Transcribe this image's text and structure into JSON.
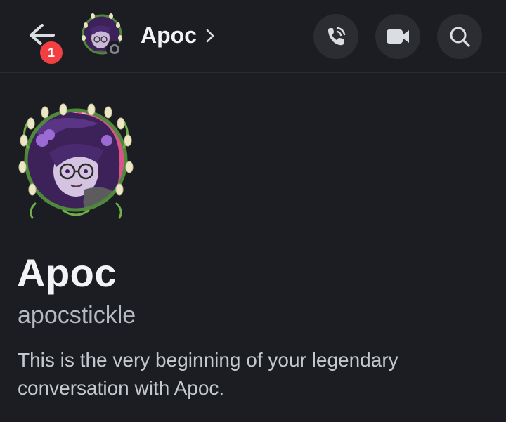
{
  "header": {
    "notification_count": "1",
    "title": "Apoc",
    "avatar_icon": "user-avatar",
    "status": "offline",
    "actions": [
      {
        "name": "voice-call",
        "icon": "phone-call-icon"
      },
      {
        "name": "video-call",
        "icon": "video-camera-icon"
      },
      {
        "name": "search",
        "icon": "search-icon"
      }
    ]
  },
  "profile": {
    "display_name": "Apoc",
    "username": "apocstickle",
    "intro": "This is the very beginning of your legendary conversation with Apoc."
  },
  "colors": {
    "background": "#1c1d22",
    "badge": "#f23f42",
    "button_bg": "#2b2d33",
    "muted_text": "#b5bac1",
    "wreath_green": "#4e8a3a",
    "avatar_purple": "#4a2a6e",
    "avatar_pink": "#e3447d"
  }
}
